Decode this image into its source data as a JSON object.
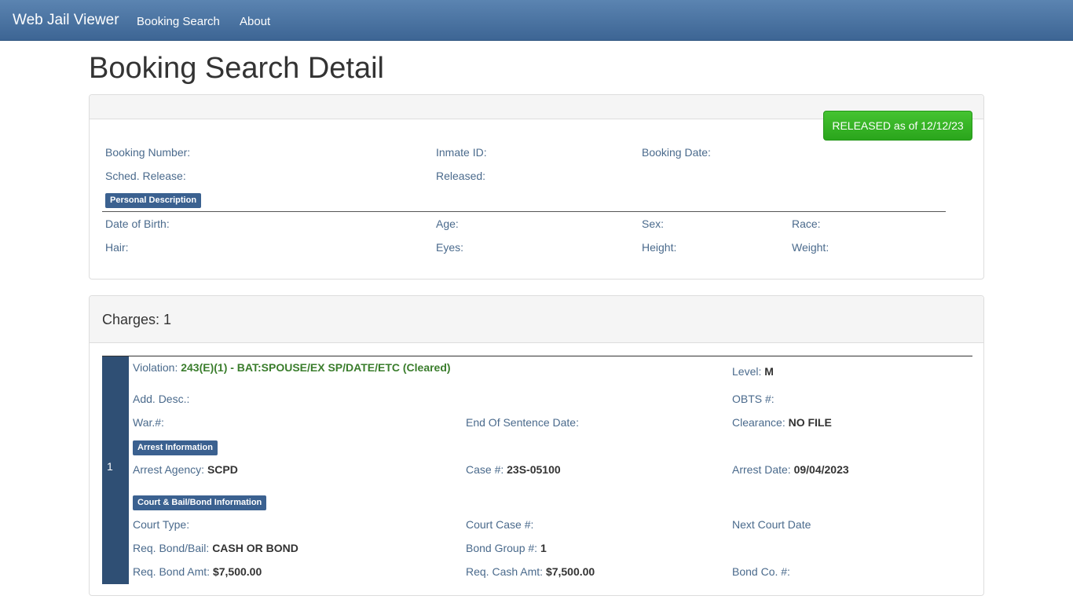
{
  "navbar": {
    "brand": "Web Jail Viewer",
    "links": [
      "Booking Search",
      "About"
    ]
  },
  "page_title": "Booking Search Detail",
  "status": {
    "label": "RELEASED as of 12/12/23",
    "color": "#2aa51c"
  },
  "booking": {
    "booking_number_label": "Booking Number:",
    "inmate_id_label": "Inmate ID:",
    "booking_date_label": "Booking Date:",
    "sched_release_label": "Sched. Release:",
    "released_label": "Released:"
  },
  "personal": {
    "section_label": "Personal Description",
    "dob_label": "Date of Birth:",
    "age_label": "Age:",
    "sex_label": "Sex:",
    "race_label": "Race:",
    "hair_label": "Hair:",
    "eyes_label": "Eyes:",
    "height_label": "Height:",
    "weight_label": "Weight:"
  },
  "charges": {
    "title": "Charges: 1",
    "items": [
      {
        "index": "1",
        "violation_label": "Violation:",
        "violation_value": "243(E)(1) - BAT:SPOUSE/EX SP/DATE/ETC (Cleared)",
        "level_label": "Level:",
        "level_value": "M",
        "add_desc_label": "Add. Desc.:",
        "obts_label": "OBTS #:",
        "warrant_label": "War.#:",
        "end_sentence_label": "End Of Sentence Date:",
        "clearance_label": "Clearance:",
        "clearance_value": "NO FILE",
        "arrest_section_label": "Arrest Information",
        "arrest_agency_label": "Arrest Agency:",
        "arrest_agency_value": "SCPD",
        "case_label": "Case #:",
        "case_value": "23S-05100",
        "arrest_date_label": "Arrest Date:",
        "arrest_date_value": "09/04/2023",
        "court_section_label": "Court & Bail/Bond Information",
        "court_type_label": "Court Type:",
        "court_case_label": "Court Case #:",
        "next_court_label": "Next Court Date",
        "req_bond_bail_label": "Req. Bond/Bail:",
        "req_bond_bail_value": "CASH OR BOND",
        "bond_group_label": "Bond Group #:",
        "bond_group_value": "1",
        "req_bond_amt_label": "Req. Bond Amt:",
        "req_bond_amt_value": "$7,500.00",
        "req_cash_amt_label": "Req. Cash Amt:",
        "req_cash_amt_value": "$7,500.00",
        "bond_co_label": "Bond Co. #:"
      }
    ]
  }
}
